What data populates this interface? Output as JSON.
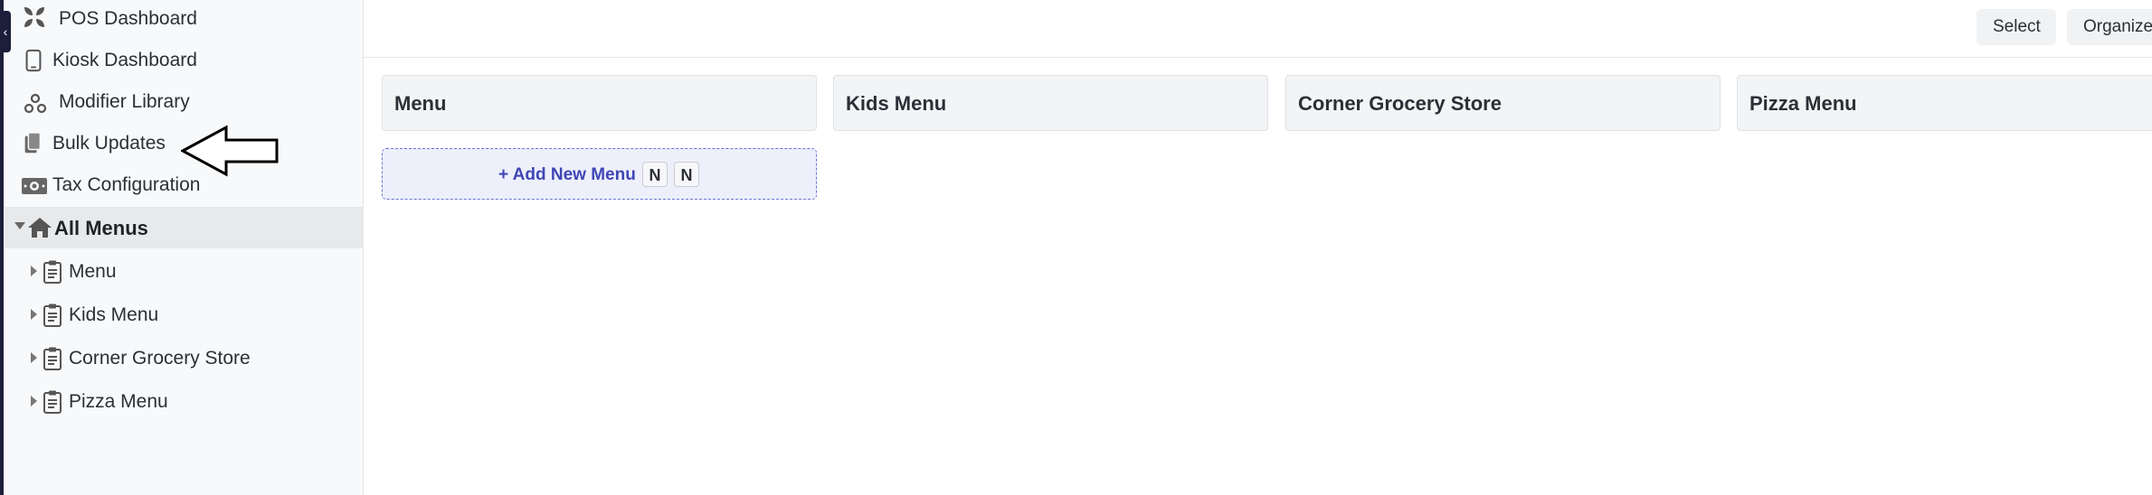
{
  "sidebar": {
    "collapse_glyph": "‹",
    "nav": [
      {
        "label": "POS Dashboard",
        "icon": "pos-dashboard-icon"
      },
      {
        "label": "Kiosk Dashboard",
        "icon": "tablet-icon"
      },
      {
        "label": "Modifier Library",
        "icon": "modifier-icon"
      },
      {
        "label": "Bulk Updates",
        "icon": "copy-icon"
      },
      {
        "label": "Tax Configuration",
        "icon": "money-icon"
      }
    ],
    "all_menus": {
      "label": "All Menus",
      "icon": "home-icon"
    },
    "menus": [
      {
        "label": "Menu",
        "icon": "clipboard-icon"
      },
      {
        "label": "Kids Menu",
        "icon": "clipboard-icon"
      },
      {
        "label": "Corner Grocery Store",
        "icon": "clipboard-icon"
      },
      {
        "label": "Pizza Menu",
        "icon": "clipboard-icon"
      }
    ]
  },
  "toolbar": {
    "select_label": "Select",
    "organize_label": "Organize"
  },
  "main": {
    "menu_cards": [
      {
        "label": "Menu"
      },
      {
        "label": "Kids Menu"
      },
      {
        "label": "Corner Grocery Store"
      },
      {
        "label": "Pizza Menu"
      }
    ],
    "add_menu": {
      "label": "+ Add New Menu",
      "shortcut_keys": [
        "N",
        "N"
      ]
    }
  },
  "colors": {
    "accent": "#4046b5",
    "sidebar_bg": "#f8f9fa",
    "selected_bg": "#e8e9eb"
  }
}
